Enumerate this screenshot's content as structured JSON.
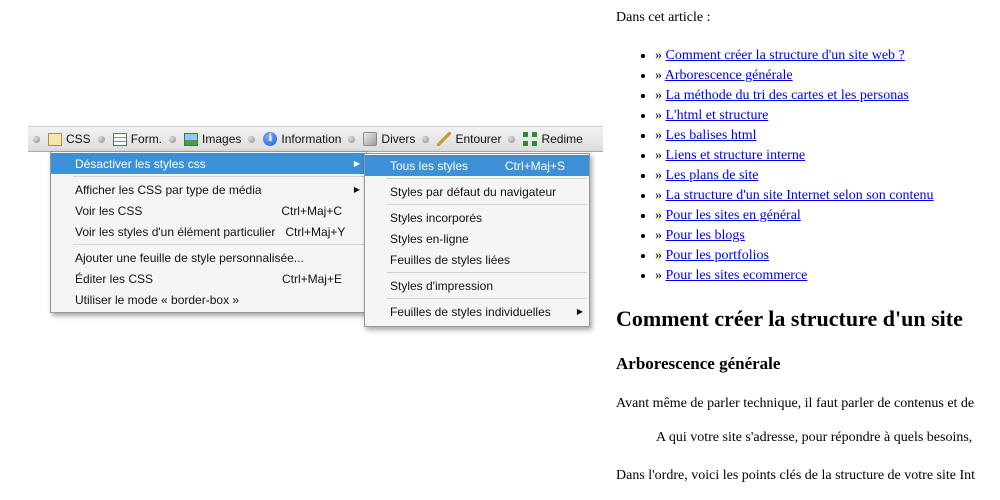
{
  "toolbar": {
    "items": [
      {
        "label": "CSS",
        "icon": "css-icon"
      },
      {
        "label": "Form.",
        "icon": "form-icon"
      },
      {
        "label": "Images",
        "icon": "images-icon"
      },
      {
        "label": "Information",
        "icon": "info-icon"
      },
      {
        "label": "Divers",
        "icon": "cube-icon"
      },
      {
        "label": "Entourer",
        "icon": "pencil-icon"
      },
      {
        "label": "Redime",
        "icon": "resize-icon"
      }
    ]
  },
  "css_menu": {
    "items": [
      {
        "label": "Désactiver les styles css",
        "shortcut": ""
      },
      {
        "label": "Afficher les CSS par type de média",
        "shortcut": ""
      },
      {
        "label": "Voir les CSS",
        "shortcut": "Ctrl+Maj+C"
      },
      {
        "label": "Voir les styles d'un élément particulier",
        "shortcut": "Ctrl+Maj+Y"
      },
      {
        "label": "Ajouter une feuille de style personnalisée...",
        "shortcut": ""
      },
      {
        "label": "Éditer les CSS",
        "shortcut": "Ctrl+Maj+E"
      },
      {
        "label": "Utiliser le mode « border-box »",
        "shortcut": ""
      }
    ]
  },
  "disable_submenu": {
    "items": [
      {
        "label": "Tous les styles",
        "shortcut": "Ctrl+Maj+S"
      },
      {
        "label": "Styles par défaut du navigateur",
        "shortcut": ""
      },
      {
        "label": "Styles incorporés",
        "shortcut": ""
      },
      {
        "label": "Styles en-ligne",
        "shortcut": ""
      },
      {
        "label": "Feuilles de styles liées",
        "shortcut": ""
      },
      {
        "label": "Styles d'impression",
        "shortcut": ""
      },
      {
        "label": "Feuilles de styles individuelles",
        "shortcut": ""
      }
    ]
  },
  "article": {
    "intro": "Dans cet article :",
    "toc_prefix": "»",
    "toc": [
      "Comment créer la structure d'un site web ?",
      "Arborescence générale",
      "La méthode du tri des cartes et les personas",
      "L'html et structure",
      "Les balises html",
      "Liens et structure interne",
      "Les plans de site",
      "La structure d'un site Internet selon son contenu",
      "Pour les sites en général",
      "Pour les blogs",
      "Pour les portfolios",
      "Pour les sites ecommerce"
    ],
    "heading1": "Comment créer la structure d'un site",
    "heading2": "Arborescence générale",
    "para1": "Avant même de parler technique, il faut parler de contenus et de",
    "para2": "A qui votre site s'adresse, pour répondre à quels besoins,",
    "para3": "Dans l'ordre, voici les points clés de la structure de votre site Int"
  },
  "colors": {
    "highlight": "#3d8fd6",
    "link": "#0000ee"
  }
}
